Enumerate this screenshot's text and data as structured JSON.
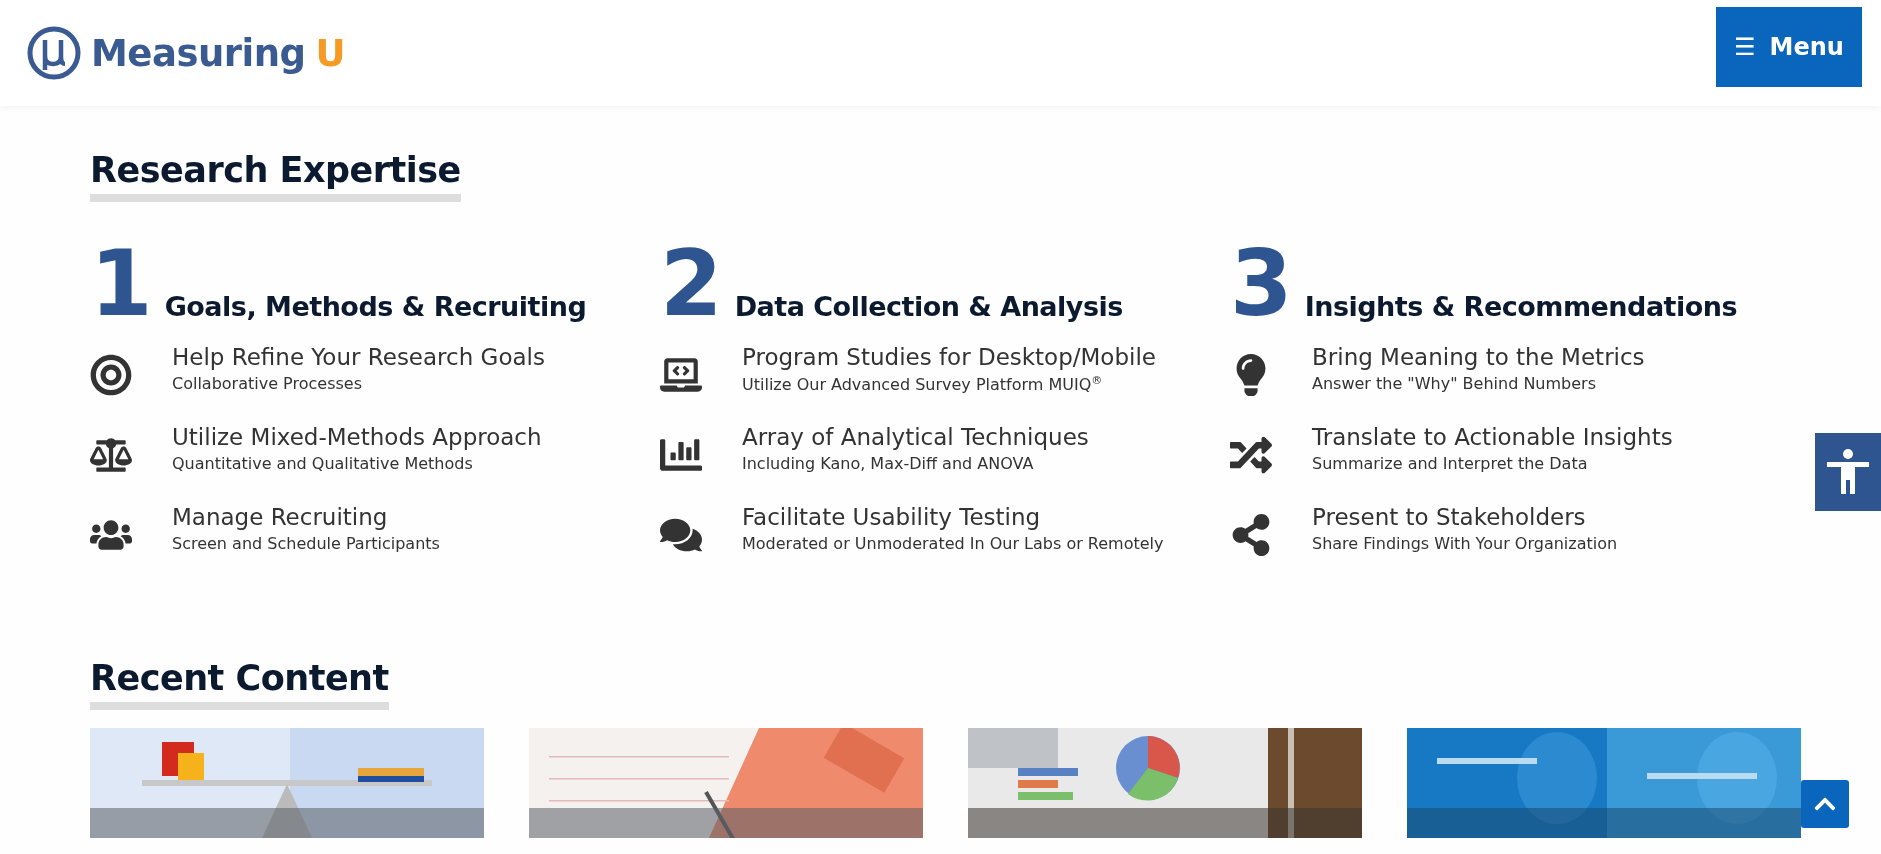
{
  "header": {
    "logo": {
      "name": "Measuring",
      "accent": "U"
    },
    "menu_button": {
      "icon": "☰",
      "label": "Menu"
    }
  },
  "research": {
    "title": "Research Expertise",
    "columns": [
      {
        "number": "1",
        "heading": "Goals, Methods & Recruiting",
        "items": [
          {
            "title": "Help Refine Your Research Goals",
            "subtitle": "Collaborative Processes"
          },
          {
            "title": "Utilize Mixed-Methods Approach",
            "subtitle": "Quantitative and Qualitative Methods"
          },
          {
            "title": "Manage Recruiting",
            "subtitle": "Screen and Schedule Participants"
          }
        ]
      },
      {
        "number": "2",
        "heading": "Data Collection & Analysis",
        "items": [
          {
            "title": "Program Studies for Desktop/Mobile",
            "subtitle": "Utilize Our Advanced Survey Platform MUIQ$^{®}$"
          },
          {
            "title": "Array of Analytical Techniques",
            "subtitle": "Including Kano, Max-Diff and ANOVA"
          },
          {
            "title": "Facilitate Usability Testing",
            "subtitle": "Moderated or Unmoderated In Our Labs or Remotely"
          }
        ]
      },
      {
        "number": "3",
        "heading": "Insights & Recommendations",
        "items": [
          {
            "title": "Bring Meaning to the Metrics",
            "subtitle": "Answer the \"Why\" Behind Numbers"
          },
          {
            "title": "Translate to Actionable Insights",
            "subtitle": "Summarize and Interpret the Data"
          },
          {
            "title": "Present to Stakeholders",
            "subtitle": "Share Findings With Your Organization"
          }
        ]
      }
    ]
  },
  "recent": {
    "title": "Recent Content"
  }
}
